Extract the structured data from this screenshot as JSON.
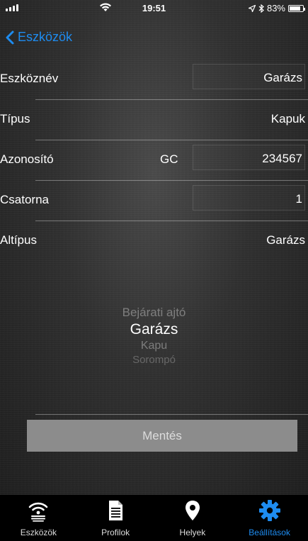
{
  "status_bar": {
    "time": "19:51",
    "battery_text": "83%",
    "battery_level": 0.83,
    "icons": [
      "signal-icon",
      "wifi-icon",
      "location-arrow-icon",
      "bluetooth-icon",
      "battery-icon"
    ]
  },
  "nav": {
    "back_label": "Eszközök"
  },
  "form": {
    "device_name": {
      "label": "Eszköznév",
      "value": "Garázs"
    },
    "type": {
      "label": "Típus",
      "value": "Kapuk"
    },
    "identifier": {
      "label": "Azonosító",
      "prefix": "GC",
      "value": "234567"
    },
    "channel": {
      "label": "Csatorna",
      "value": "1"
    },
    "subtype": {
      "label": "Altípus",
      "value": "Garázs"
    }
  },
  "picker": {
    "options": [
      "Bejárati ajtó",
      "Garázs",
      "Kapu",
      "Sorompó"
    ],
    "selected": "Garázs"
  },
  "save_button": {
    "label": "Mentés"
  },
  "tabs": [
    {
      "label": "Eszközök",
      "icon": "wireless-remote-icon",
      "active": false
    },
    {
      "label": "Profilok",
      "icon": "document-icon",
      "active": false
    },
    {
      "label": "Helyek",
      "icon": "map-pin-icon",
      "active": false
    },
    {
      "label": "Beállítások",
      "icon": "gear-icon",
      "active": true
    }
  ],
  "colors": {
    "accent": "#1e8cf0",
    "button": "#8c8c8c",
    "tabbar": "#000000"
  }
}
